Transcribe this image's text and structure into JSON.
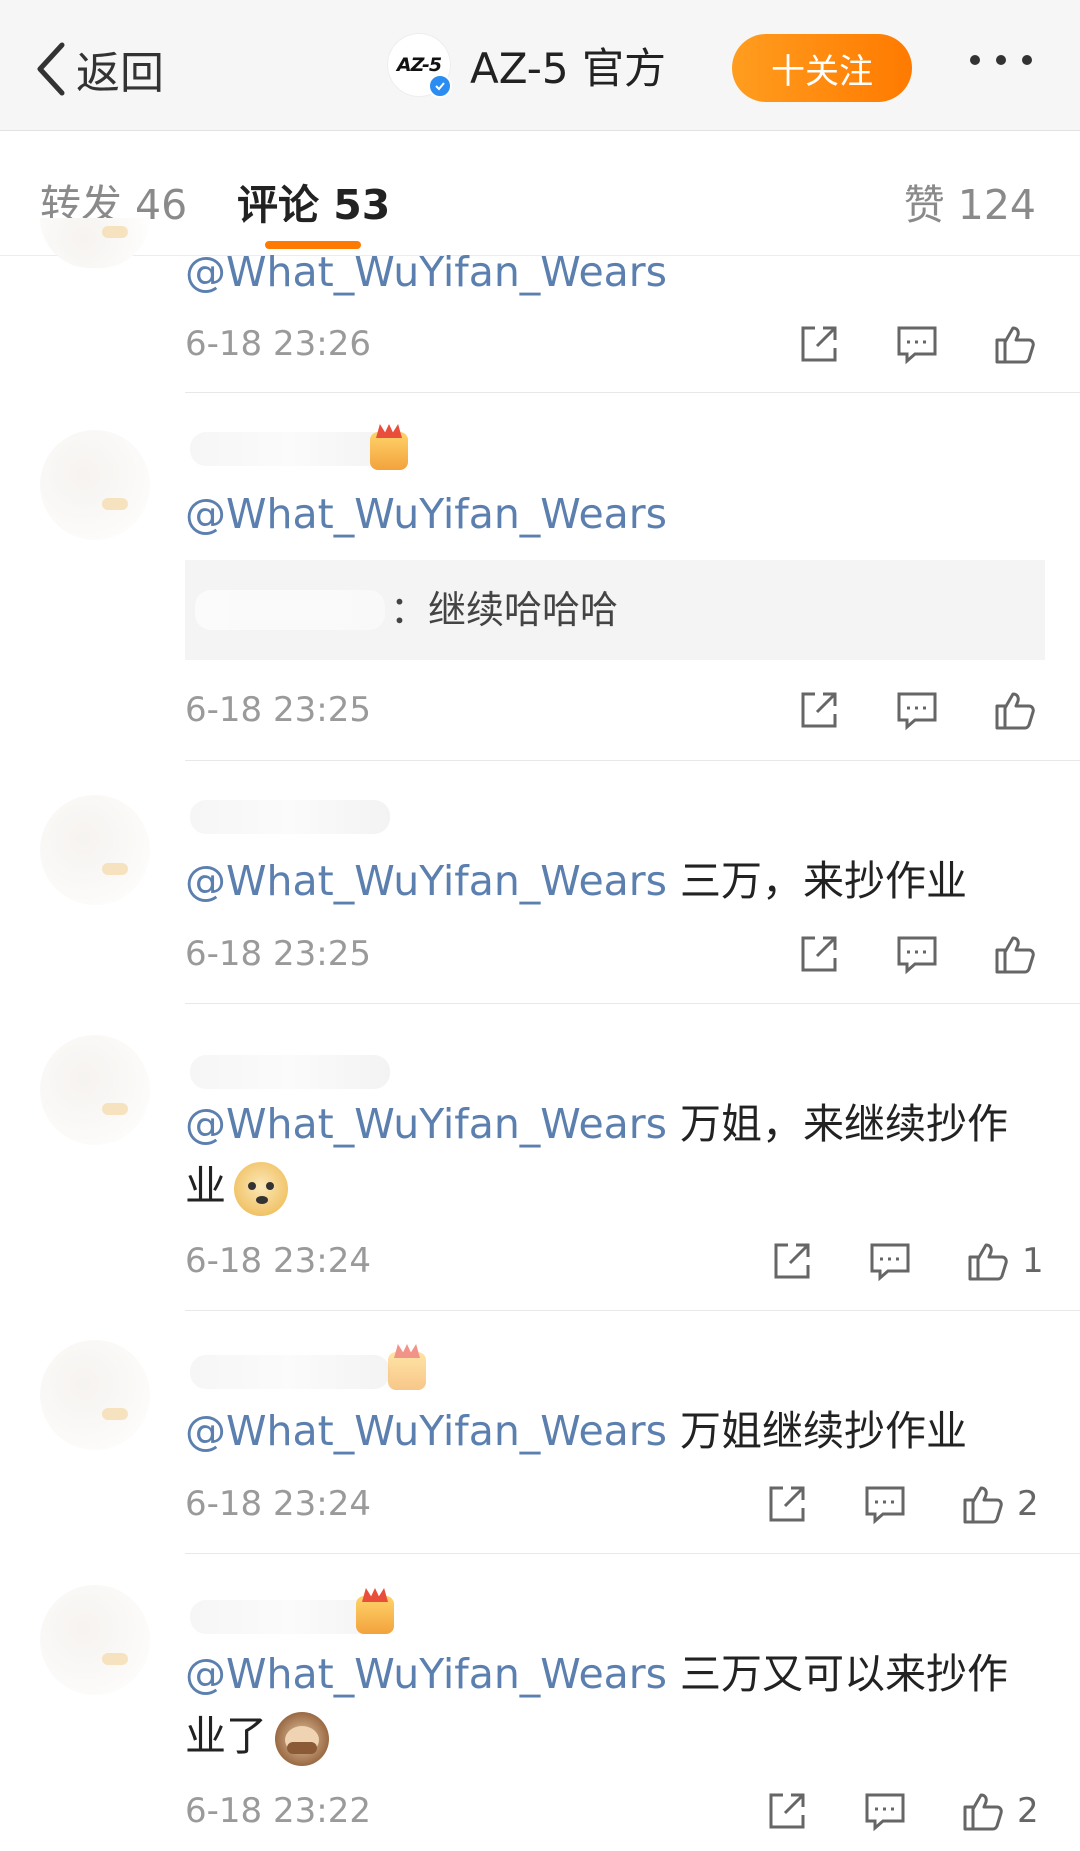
{
  "nav": {
    "back_label": "返回",
    "logo_text": "AZ-5",
    "account_name": "AZ-5 官方",
    "follow_label": "十关注"
  },
  "tabs": {
    "repost": "转发 46",
    "comment": "评论 53",
    "like": "赞 124"
  },
  "colors": {
    "accent": "#ff7a00",
    "mention": "#5b7fae",
    "verified": "#2b8cf1"
  },
  "comments": [
    {
      "mention": "@What_WuYifan_Wears",
      "text": "",
      "time": "6-18 23:26",
      "likes": ""
    },
    {
      "mention": "@What_WuYifan_Wears",
      "text": "",
      "quote": "：继续哈哈哈",
      "time": "6-18 23:25",
      "likes": ""
    },
    {
      "mention": "@What_WuYifan_Wears",
      "text": " 三万，来抄作业",
      "time": "6-18 23:25",
      "likes": ""
    },
    {
      "mention": "@What_WuYifan_Wears",
      "text": " 万姐，来继续抄作业",
      "emoji": "doge-emoji",
      "time": "6-18 23:24",
      "likes": "1"
    },
    {
      "mention": "@What_WuYifan_Wears",
      "text": " 万姐继续抄作业",
      "time": "6-18 23:24",
      "likes": "2"
    },
    {
      "mention": "@What_WuYifan_Wears",
      "text": " 三万又可以来抄作业了",
      "emoji": "see-no-evil-monkey-emoji",
      "time": "6-18 23:22",
      "likes": "2"
    }
  ]
}
